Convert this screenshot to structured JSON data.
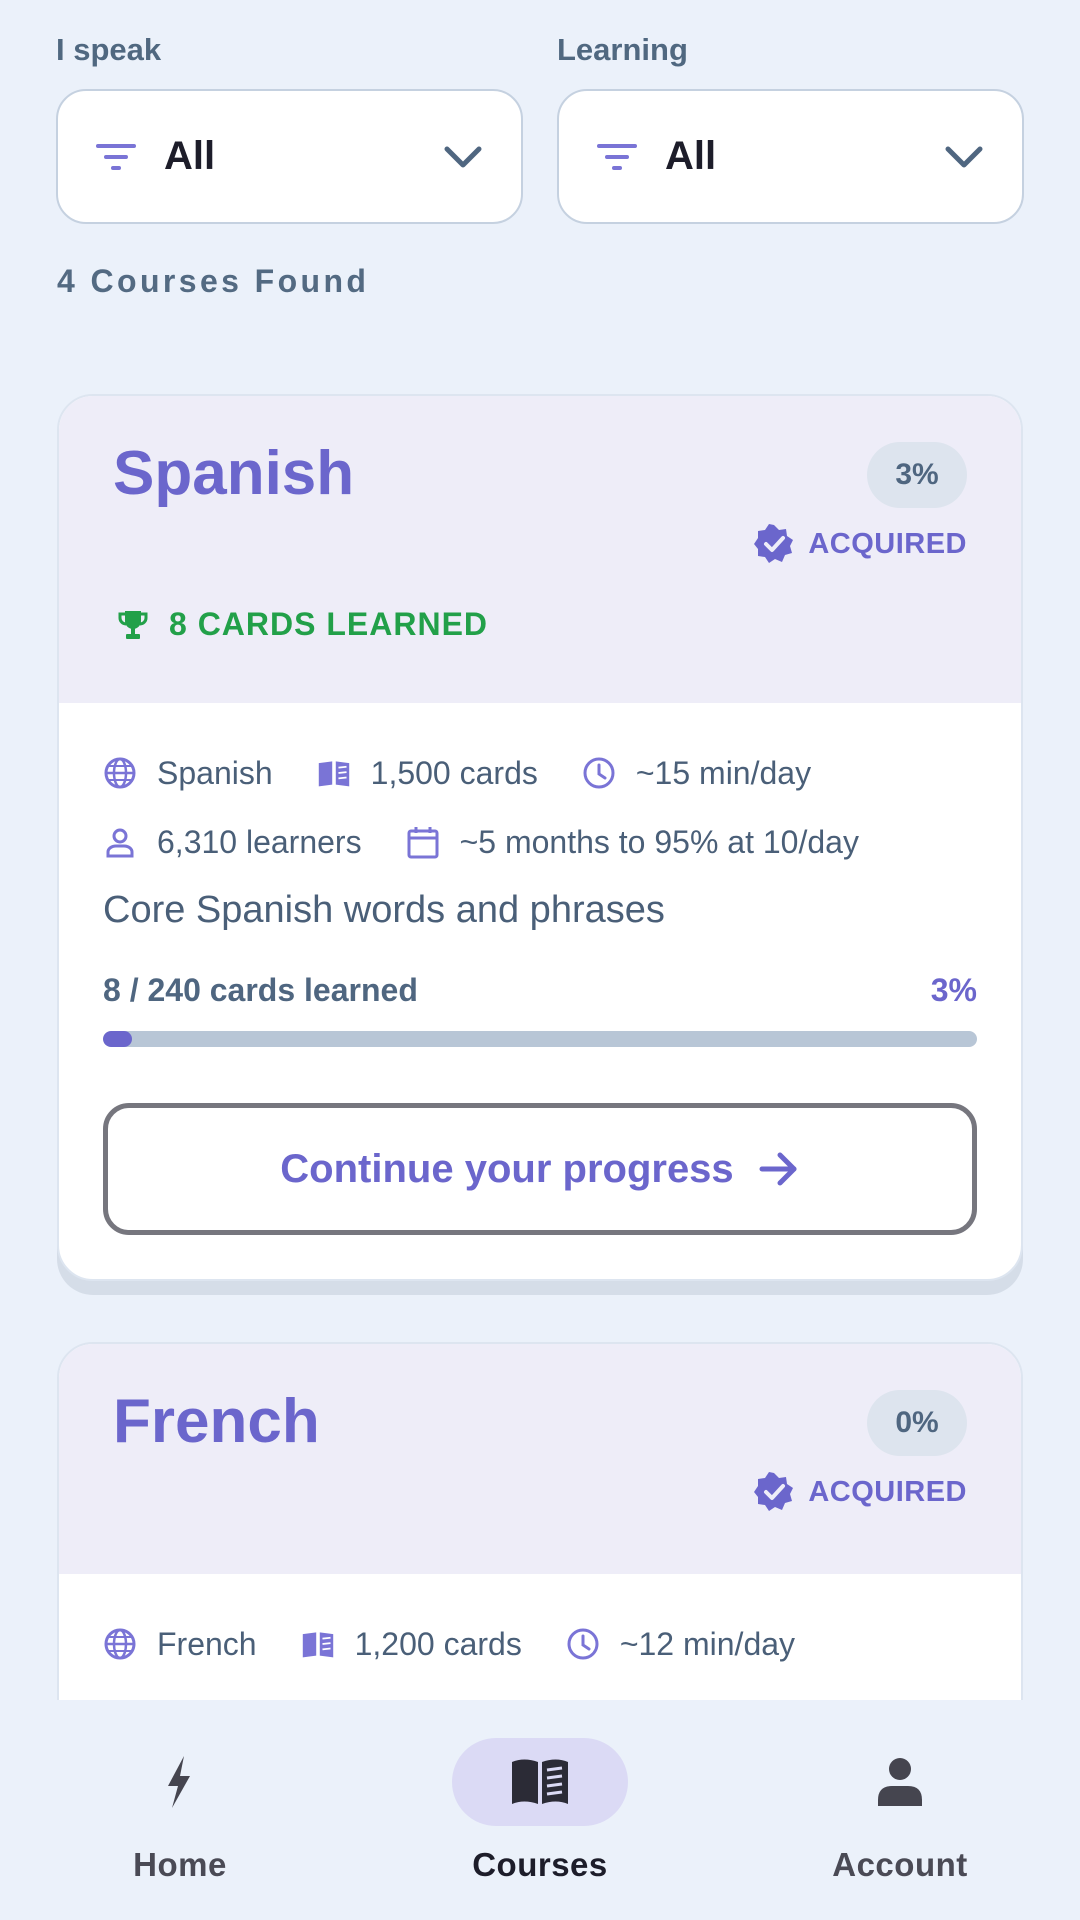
{
  "filters": {
    "speak_label": "I speak",
    "speak_value": "All",
    "learning_label": "Learning",
    "learning_value": "All"
  },
  "results_text": "4 Courses Found",
  "courses": [
    {
      "title": "Spanish",
      "percent_badge": "3%",
      "acquired_label": "ACQUIRED",
      "learned_badge": "8 CARDS LEARNED",
      "language": "Spanish",
      "cards": "1,500 cards",
      "time_per_day": "~15 min/day",
      "learners": "6,310 learners",
      "eta": "~5 months to 95% at 10/day",
      "description": "Core Spanish words and phrases",
      "progress_text": "8 / 240 cards learned",
      "progress_percent": "3%",
      "progress_value": 0.033,
      "cta_label": "Continue your progress"
    },
    {
      "title": "French",
      "percent_badge": "0%",
      "acquired_label": "ACQUIRED",
      "language": "French",
      "cards": "1,200 cards",
      "time_per_day": "~12 min/day"
    }
  ],
  "nav": {
    "items": [
      {
        "label": "Home",
        "icon": "bolt-icon",
        "active": false
      },
      {
        "label": "Courses",
        "icon": "book-icon",
        "active": true
      },
      {
        "label": "Account",
        "icon": "person-icon",
        "active": false
      }
    ]
  },
  "colors": {
    "accent": "#6b66cc",
    "success": "#22a049",
    "background": "#ebf1fa"
  }
}
